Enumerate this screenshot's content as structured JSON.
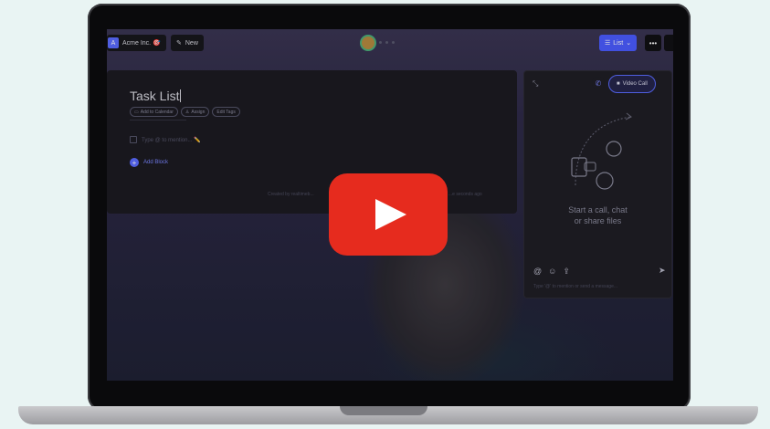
{
  "topbar": {
    "org_avatar": "A",
    "org_name": "Acme Inc. 🎯",
    "new_label": "New",
    "view_label": "List",
    "more_label": "•••"
  },
  "document": {
    "title": "Task List",
    "chips": [
      "Add to Calendar",
      "Assign",
      "Edit Tags"
    ],
    "task_placeholder": "Type @ to mention... ✏️",
    "add_block_label": "Add Block",
    "created_by": "Created by realtimeb...",
    "updated": "...e seconds ago"
  },
  "chat": {
    "video_call_label": "Video Call",
    "empty_line1": "Start a call, chat",
    "empty_line2": "or share files",
    "input_placeholder": "Type '@' to mention or send a message..."
  },
  "colors": {
    "accent": "#5b6bff",
    "play_red": "#e62b1e",
    "page_bg": "#e9f4f3"
  }
}
